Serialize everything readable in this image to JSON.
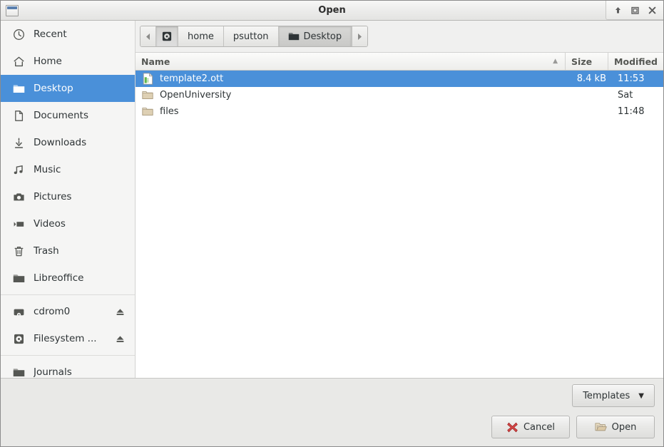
{
  "window": {
    "title": "Open",
    "icon": "window-icon",
    "controls": [
      {
        "name": "shade-button",
        "glyph": "up-arrow-icon"
      },
      {
        "name": "maximize-button",
        "glyph": "maximize-icon"
      },
      {
        "name": "close-button",
        "glyph": "close-icon"
      }
    ]
  },
  "sidebar": {
    "groups": [
      {
        "items": [
          {
            "label": "Recent",
            "icon": "clock-icon",
            "selected": false,
            "eject": false
          },
          {
            "label": "Home",
            "icon": "home-icon",
            "selected": false,
            "eject": false
          },
          {
            "label": "Desktop",
            "icon": "folder-icon",
            "selected": true,
            "eject": false
          },
          {
            "label": "Documents",
            "icon": "document-icon",
            "selected": false,
            "eject": false
          },
          {
            "label": "Downloads",
            "icon": "download-icon",
            "selected": false,
            "eject": false
          },
          {
            "label": "Music",
            "icon": "music-note-icon",
            "selected": false,
            "eject": false
          },
          {
            "label": "Pictures",
            "icon": "camera-icon",
            "selected": false,
            "eject": false
          },
          {
            "label": "Videos",
            "icon": "video-icon",
            "selected": false,
            "eject": false
          },
          {
            "label": "Trash",
            "icon": "trash-icon",
            "selected": false,
            "eject": false
          },
          {
            "label": "Libreoffice",
            "icon": "folder-icon",
            "selected": false,
            "eject": false
          }
        ]
      },
      {
        "items": [
          {
            "label": "cdrom0",
            "icon": "optical-drive-icon",
            "selected": false,
            "eject": true
          },
          {
            "label": "Filesystem ...",
            "icon": "harddisk-icon",
            "selected": false,
            "eject": true
          }
        ]
      },
      {
        "items": [
          {
            "label": "Journals",
            "icon": "folder-icon",
            "selected": false,
            "eject": false
          }
        ]
      }
    ]
  },
  "pathbar": {
    "prev_label": "◀",
    "next_label": "▶",
    "crumbs": [
      {
        "label": "",
        "icon": "harddisk-icon",
        "state": "pressed",
        "icon_only": true
      },
      {
        "label": "home",
        "icon": "",
        "state": "normal",
        "icon_only": false
      },
      {
        "label": "psutton",
        "icon": "",
        "state": "normal",
        "icon_only": false
      },
      {
        "label": "Desktop",
        "icon": "folder-icon",
        "state": "active",
        "icon_only": false
      }
    ]
  },
  "filelist": {
    "columns": {
      "name": "Name",
      "size": "Size",
      "modified": "Modified",
      "sort_indicator": "▲"
    },
    "rows": [
      {
        "name": "template2.ott",
        "size": "8.4 kB",
        "modified": "11:53",
        "icon": "ott-template-icon",
        "selected": true
      },
      {
        "name": "OpenUniversity",
        "size": "",
        "modified": "Sat",
        "icon": "folder-icon",
        "selected": false
      },
      {
        "name": "files",
        "size": "",
        "modified": "11:48",
        "icon": "folder-icon",
        "selected": false
      }
    ]
  },
  "footer": {
    "templates_label": "Templates",
    "templates_caret": "▼",
    "cancel_label": "Cancel",
    "open_label": "Open"
  },
  "colors": {
    "selection_blue": "#4a90d9",
    "titlebar_bg": "#ececeb",
    "sidebar_bg": "#f5f5f4",
    "footer_bg": "#e9e9e7",
    "folder_tan": "#d9c7a7",
    "cancel_red": "#cc3333"
  }
}
